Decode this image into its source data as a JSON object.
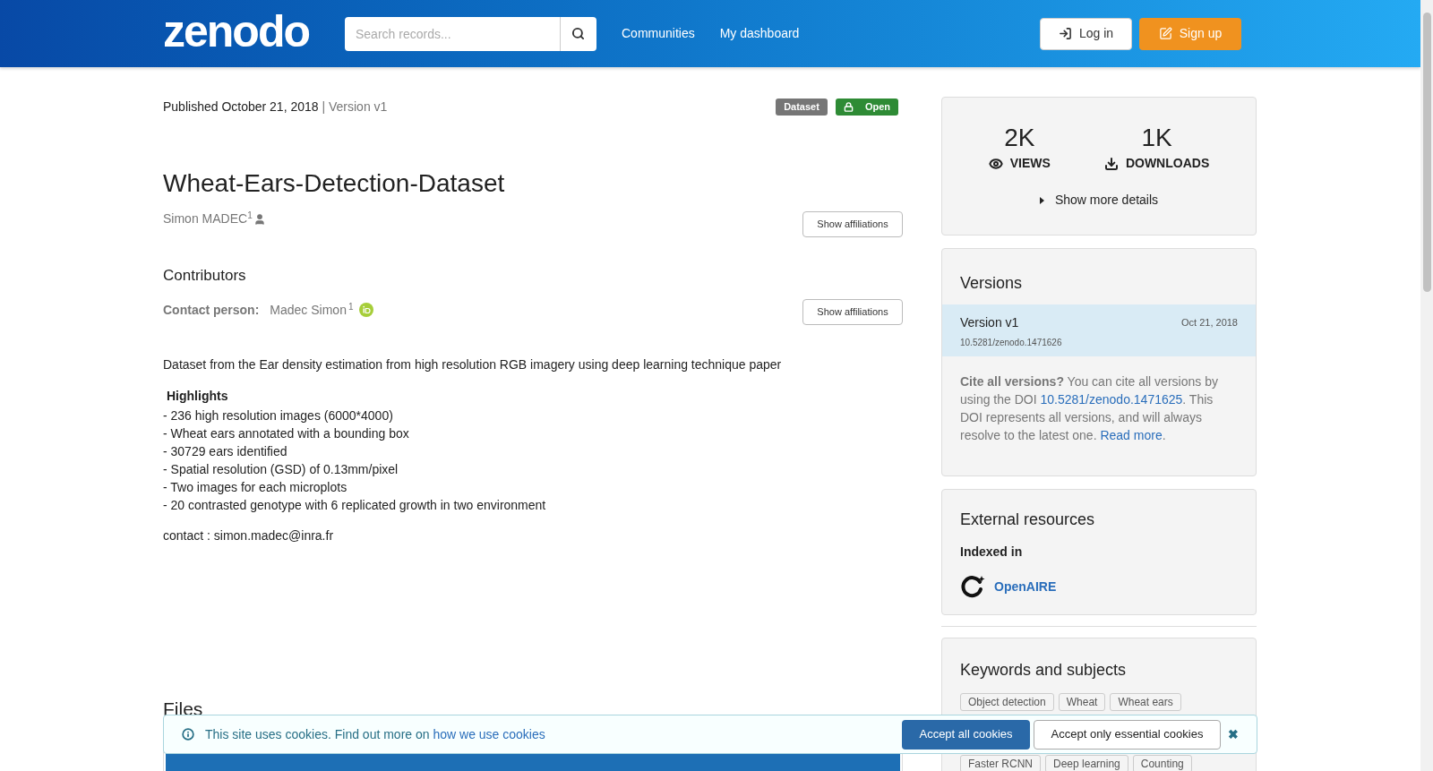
{
  "header": {
    "logo": "zenodo",
    "search": {
      "placeholder": "Search records..."
    },
    "nav": [
      "Communities",
      "My dashboard"
    ],
    "login": "Log in",
    "signup": "Sign up"
  },
  "record": {
    "published": "Published October 21, 2018",
    "version": "| Version v1",
    "badges": [
      {
        "label": "Dataset",
        "kind": "type"
      },
      {
        "label": "Open",
        "kind": "access"
      }
    ],
    "title": "Wheat-Ears-Detection-Dataset",
    "creator": {
      "name": "Simon MADEC",
      "sup": "1"
    },
    "show_affiliations": "Show affiliations",
    "contributors_heading": "Contributors",
    "contact_label": "Contact person:",
    "contact": {
      "name": "Madec Simon",
      "sup": "1"
    },
    "show_affiliations_2": "Show affiliations",
    "description": "Dataset from the Ear density estimation from high resolution RGB imagery using deep learning technique paper",
    "highlights_heading": "Highlights",
    "highlights": [
      "- 236 high resolution images (6000*4000)",
      "- Wheat ears annotated with a bounding box",
      "- 30729 ears identified",
      "- Spatial resolution (GSD) of 0.13mm/pixel",
      "- Two images for each microplots",
      "- 20 contrasted genotype with 6 replicated growth in two environment"
    ],
    "contact_line": "contact : simon.madec@inra.fr",
    "files_heading": "Files"
  },
  "stats": {
    "views": "2K",
    "views_label": "VIEWS",
    "downloads": "1K",
    "downloads_label": "DOWNLOADS",
    "more": "Show more details",
    "expanded": false
  },
  "versions": {
    "heading": "Versions",
    "items": [
      {
        "name": "Version v1",
        "date": "Oct 21, 2018",
        "doi": "10.5281/zenodo.1471626",
        "selected": true
      }
    ],
    "cite_bold": "Cite all versions?",
    "cite_1": " You can cite all versions by using the DOI ",
    "cite_link": "10.5281/zenodo.1471625",
    "cite_2": ". This DOI represents all versions, and will always resolve to the latest one. ",
    "read_more": "Read more",
    "cite_end": "."
  },
  "external": {
    "heading": "External resources",
    "indexed": "Indexed in",
    "link": "OpenAIRE"
  },
  "keywords": {
    "heading": "Keywords and subjects",
    "tags": [
      "Object detection",
      "Wheat",
      "Wheat ears",
      "Faster RCNN",
      "Deep learning",
      "Counting"
    ]
  },
  "cookies": {
    "text": "This site uses cookies. Find out more on ",
    "link": "how we use cookies",
    "accept_all": "Accept all cookies",
    "accept_essential": "Accept only essential cookies",
    "close": "✖"
  }
}
